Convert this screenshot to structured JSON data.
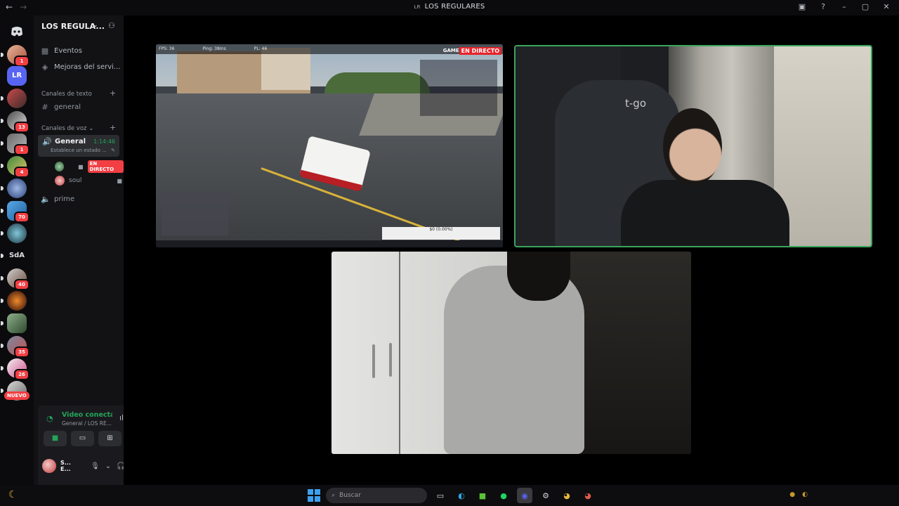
{
  "window": {
    "title": "LOS REGULARES",
    "server_mini": "LR"
  },
  "rail": {
    "lr_label": "LR",
    "sda_label": "SdA",
    "badges": [
      "1",
      "1",
      "13",
      "1",
      "4",
      "70",
      "40",
      "35",
      "26"
    ],
    "nuevo": "NUEVO"
  },
  "server": {
    "name": "LOS REGULA...",
    "events": "Eventos",
    "boosts": "Mejoras del servi...",
    "text_category": "Canales de texto",
    "text_channel": "general",
    "voice_category": "Canales de voz",
    "voice_channel": "General",
    "voice_timer": "1:14:46",
    "voice_status": "Establece un estado ...",
    "live_badge": "EN DIRECTO",
    "user2": "soul",
    "voice_channel2": "prime"
  },
  "voice_panel": {
    "title": "Video conectado",
    "subtitle": "General / LOS RE...",
    "user": "S... E..."
  },
  "stage": {
    "game_live": "EN DIRECTO",
    "game_tag": "GAME: P",
    "game_hud_fps": "FPS: 36",
    "game_hud_ping": "Ping: 38ms",
    "game_hud_pl": "PL: 46",
    "game_money": "$0 (0.00%)",
    "cam_brand": "t-go"
  },
  "taskbar": {
    "search_placeholder": "Buscar"
  },
  "colors": {
    "accent_green": "#23a55a",
    "live_red": "#f23f43",
    "speaking_border": "#3ba55d"
  }
}
